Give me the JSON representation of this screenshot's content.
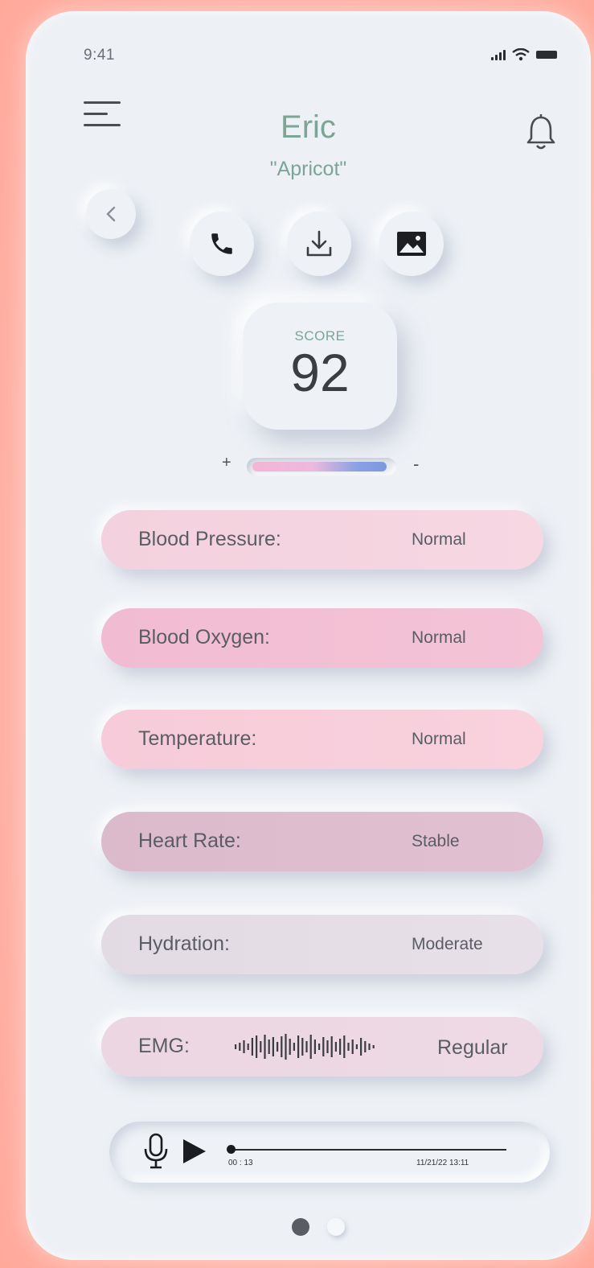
{
  "status": {
    "time": "9:41"
  },
  "header": {
    "name": "Eric",
    "nickname": "\"Apricot\""
  },
  "score": {
    "label": "SCORE",
    "value": "92"
  },
  "slider": {
    "plus": "+",
    "minus": "-",
    "level": 0.97
  },
  "metrics": [
    {
      "label": "Blood Pressure:",
      "value": "Normal"
    },
    {
      "label": "Blood Oxygen:",
      "value": "Normal"
    },
    {
      "label": "Temperature:",
      "value": "Normal"
    },
    {
      "label": "Heart Rate:",
      "value": "Stable"
    },
    {
      "label": "Hydration:",
      "value": "Moderate"
    },
    {
      "label": "EMG:",
      "value": "Regular"
    }
  ],
  "player": {
    "elapsed": "00 : 13",
    "date": "11/21/22 13:11",
    "progress": 0.0
  },
  "pagination": {
    "total": 2,
    "active": 0
  },
  "icons": [
    "menu-icon",
    "bell-icon",
    "back-chevron-icon",
    "phone-icon",
    "download-icon",
    "image-icon",
    "waveform-icon",
    "microphone-icon",
    "play-icon"
  ]
}
